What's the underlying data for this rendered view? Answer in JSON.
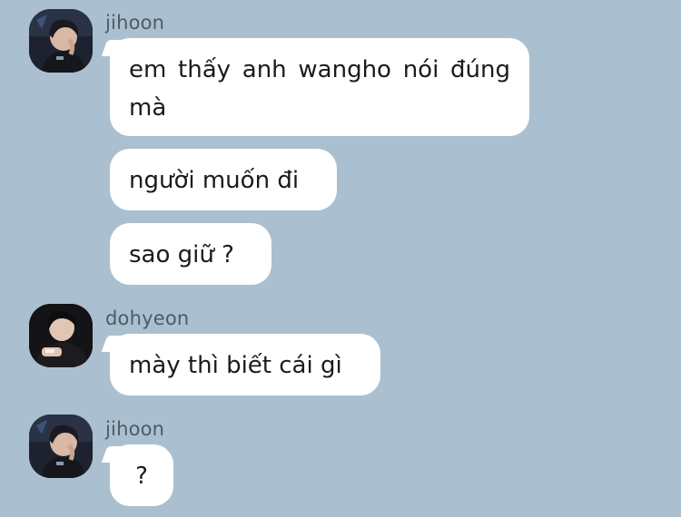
{
  "chat": {
    "groups": [
      {
        "sender": "jihoon",
        "avatar_icon": "user-avatar-icon",
        "messages": [
          "em thấy anh wangho nói đúng mà",
          "người muốn đi",
          "sao giữ ?"
        ]
      },
      {
        "sender": "dohyeon",
        "avatar_icon": "user-avatar-icon",
        "messages": [
          "mày thì biết cái gì"
        ]
      },
      {
        "sender": "jihoon",
        "avatar_icon": "user-avatar-icon",
        "messages": [
          "?"
        ]
      }
    ]
  },
  "colors": {
    "background": "#aac0d0",
    "bubble": "#ffffff",
    "sender_text": "#4f5a63",
    "message_text": "#1b1b1b"
  }
}
